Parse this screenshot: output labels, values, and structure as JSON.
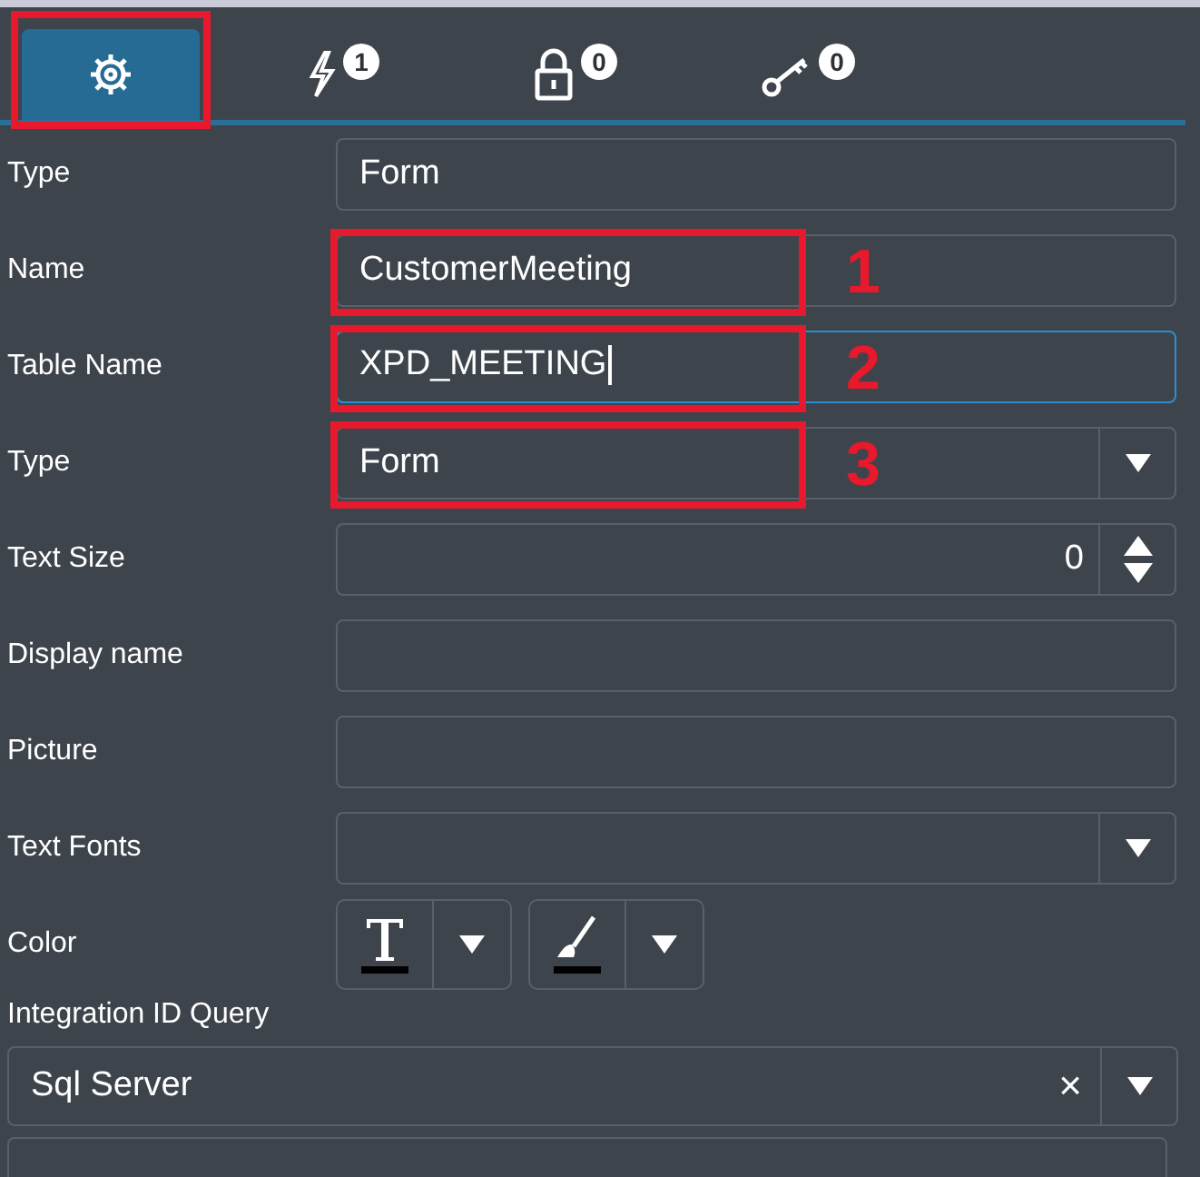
{
  "tabs": [
    {
      "kind": "gear",
      "selected": true,
      "highlighted": true
    },
    {
      "kind": "bolt",
      "count": "1",
      "selected": false,
      "highlighted": false
    },
    {
      "kind": "lock",
      "count": "0",
      "selected": false,
      "highlighted": false
    },
    {
      "kind": "key",
      "count": "0",
      "selected": false,
      "highlighted": false
    }
  ],
  "properties": [
    {
      "label": "Type",
      "kind": "text",
      "value": "Form",
      "focused": false
    },
    {
      "label": "Name",
      "kind": "text",
      "value": "CustomerMeeting",
      "focused": false,
      "callout": "1"
    },
    {
      "label": "Table Name",
      "kind": "text",
      "value": "XPD_MEETING",
      "focused": true,
      "callout": "2"
    },
    {
      "label": "Type",
      "kind": "dropdown",
      "value": "Form",
      "callout": "3"
    },
    {
      "label": "Text Size",
      "kind": "number",
      "value": "0"
    },
    {
      "label": "Display name",
      "kind": "text",
      "focused": false
    },
    {
      "label": "Picture",
      "kind": "text",
      "focused": false
    },
    {
      "label": "Text Fonts",
      "kind": "dropdown"
    },
    {
      "label": "Color",
      "kind": "color"
    }
  ],
  "integration": {
    "label": "Integration ID Query",
    "value": "Sql Server",
    "clear": "×"
  }
}
